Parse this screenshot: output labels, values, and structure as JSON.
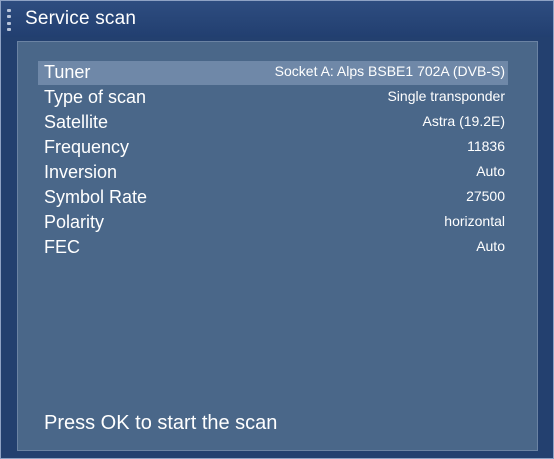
{
  "window": {
    "title": "Service scan"
  },
  "settings": {
    "rows": [
      {
        "label": "Tuner",
        "value": "Socket A: Alps BSBE1 702A (DVB-S)"
      },
      {
        "label": "Type of scan",
        "value": "Single transponder"
      },
      {
        "label": "Satellite",
        "value": "Astra (19.2E)"
      },
      {
        "label": "Frequency",
        "value": "11836"
      },
      {
        "label": "Inversion",
        "value": "Auto"
      },
      {
        "label": "Symbol Rate",
        "value": "27500"
      },
      {
        "label": "Polarity",
        "value": "horizontal"
      },
      {
        "label": "FEC",
        "value": "Auto"
      }
    ]
  },
  "footer": {
    "hint": "Press OK to start the scan"
  }
}
